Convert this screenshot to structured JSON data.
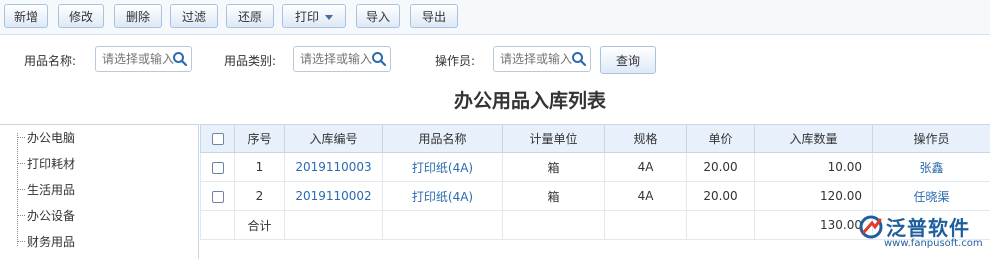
{
  "toolbar": {
    "add": "新增",
    "edit": "修改",
    "delete": "删除",
    "filter": "过滤",
    "restore": "还原",
    "print": "打印",
    "import": "导入",
    "export": "导出"
  },
  "filter": {
    "item_name_label": "用品名称:",
    "item_name_placeholder": "请选择或输入",
    "item_category_label": "用品类别:",
    "item_category_placeholder": "请选择或输入",
    "operator_label": "操作员:",
    "operator_placeholder": "请选择或输入",
    "query": "查询"
  },
  "page_title": "办公用品入库列表",
  "tree": {
    "items": [
      "办公电脑",
      "打印耗材",
      "生活用品",
      "办公设备",
      "财务用品"
    ]
  },
  "table": {
    "headers": [
      "序号",
      "入库编号",
      "用品名称",
      "计量单位",
      "规格",
      "单价",
      "入库数量",
      "操作员"
    ],
    "rows": [
      {
        "seq": "1",
        "code": "2019110003",
        "name": "打印纸(4A)",
        "unit": "箱",
        "spec": "4A",
        "price": "20.00",
        "qty": "10.00",
        "operator": "张鑫"
      },
      {
        "seq": "2",
        "code": "2019110002",
        "name": "打印纸(4A)",
        "unit": "箱",
        "spec": "4A",
        "price": "20.00",
        "qty": "120.00",
        "operator": "任晓渠"
      }
    ],
    "total_label": "合计",
    "total_qty": "130.00"
  },
  "logo": {
    "name": "泛普软件",
    "url": "www.fanpusoft.com"
  },
  "colors": {
    "link": "#2a6bb0",
    "header_bg": "#e8f1fb",
    "logo_blue": "#1f5f9e",
    "logo_red": "#e03b2b"
  }
}
